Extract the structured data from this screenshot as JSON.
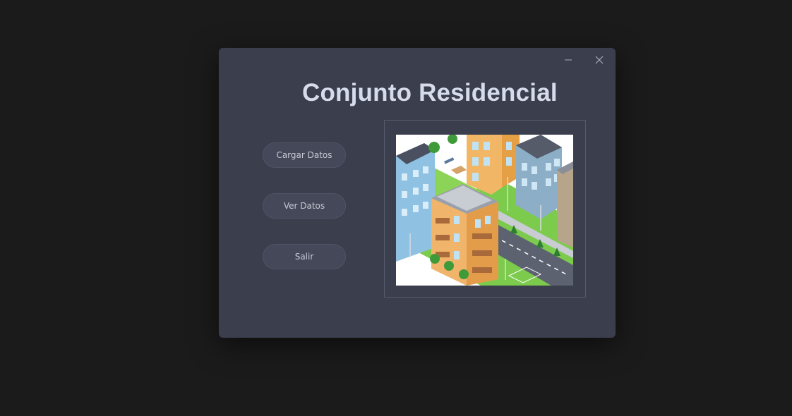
{
  "window": {
    "title": "Conjunto Residencial",
    "controls": {
      "minimize_icon": "minimize-icon",
      "close_icon": "close-icon"
    }
  },
  "buttons": {
    "load": "Cargar Datos",
    "view": "Ver Datos",
    "exit": "Salir"
  },
  "image": {
    "subject": "isometric-residential-buildings-illustration"
  },
  "colors": {
    "background": "#1b1b1c",
    "window": "#3a3e4d",
    "title": "#d7dcec",
    "button": "#444859"
  }
}
